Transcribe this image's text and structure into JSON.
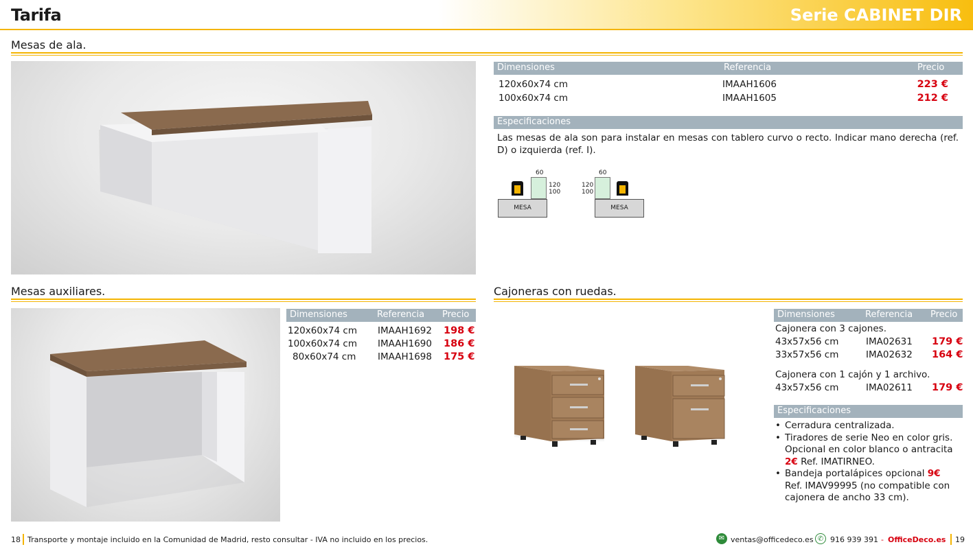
{
  "header": {
    "title": "Tarifa",
    "series": "Serie CABINET DIR"
  },
  "sections": {
    "mesas_ala": {
      "title": "Mesas de ala.",
      "table_headers": {
        "dim": "Dimensiones",
        "ref": "Referencia",
        "price": "Precio"
      },
      "rows": [
        {
          "dim": "120x60x74 cm",
          "ref": "IMAAH1606",
          "price": "223 €"
        },
        {
          "dim": "100x60x74 cm",
          "ref": "IMAAH1605",
          "price": "212 €"
        }
      ],
      "spec_header": "Especificaciones",
      "spec_text": "Las mesas de ala son para instalar en mesas con tablero curvo o recto. Indicar mano derecha (ref. D) o izquierda (ref. I).",
      "diagram": {
        "width_label": "60",
        "len1": "120",
        "len2": "100",
        "box_label": "MESA"
      }
    },
    "mesas_aux": {
      "title": "Mesas auxiliares.",
      "table_headers": {
        "dim": "Dimensiones",
        "ref": "Referencia",
        "price": "Precio"
      },
      "rows": [
        {
          "dim": "120x60x74 cm",
          "ref": "IMAAH1692",
          "price": "198 €"
        },
        {
          "dim": "100x60x74 cm",
          "ref": "IMAAH1690",
          "price": "186 €"
        },
        {
          "dim": "80x60x74 cm",
          "ref": "IMAAH1698",
          "price": "175 €"
        }
      ]
    },
    "cajoneras": {
      "title": "Cajoneras con ruedas.",
      "table_headers": {
        "dim": "Dimensiones",
        "ref": "Referencia",
        "price": "Precio"
      },
      "group1_title": "Cajonera con 3 cajones.",
      "group1_rows": [
        {
          "dim": "43x57x56 cm",
          "ref": "IMA02631",
          "price": "179 €"
        },
        {
          "dim": "33x57x56 cm",
          "ref": "IMA02632",
          "price": "164 €"
        }
      ],
      "group2_title": "Cajonera con 1 cajón y 1 archivo.",
      "group2_rows": [
        {
          "dim": "43x57x56 cm",
          "ref": "IMA02611",
          "price": "179 €"
        }
      ],
      "spec_header": "Especificaciones",
      "bullets": {
        "b1": "Cerradura centralizada.",
        "b2a": "Tiradores de serie Neo en color gris. Opcional en color blanco o antracita",
        "b2_price": "2€",
        "b2b": "Ref. IMATIRNEO.",
        "b3a": "Bandeja portalápices opcional",
        "b3_price": "9€",
        "b3b": "Ref. IMAV99995 (no compatible con cajonera de ancho 33 cm)."
      }
    }
  },
  "footer": {
    "page_left": "18",
    "note": "Transporte y montaje incluido en la Comunidad de Madrid, resto consultar - IVA no incluido en los precios.",
    "email": "ventas@officedeco.es",
    "phone": "916 939 391",
    "sep": "-",
    "brand": "OfficeDeco.es",
    "page_right": "19"
  },
  "colors": {
    "accent": "#f4b400",
    "price_red": "#d7000f",
    "table_header": "#a3b2bc",
    "wood": "#8a6a4e"
  }
}
